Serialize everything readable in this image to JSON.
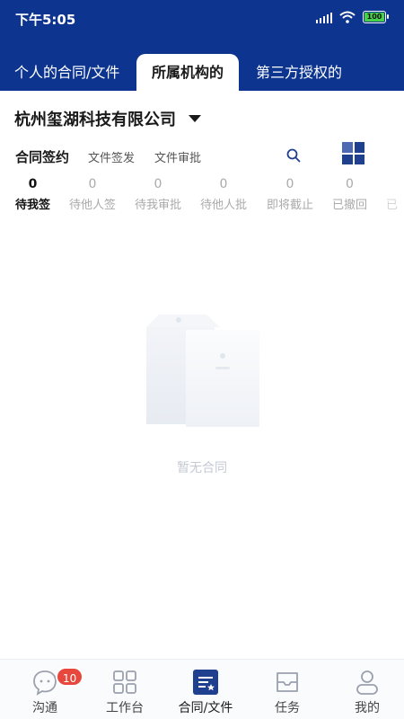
{
  "status_bar": {
    "time": "下午5:05",
    "battery": "100"
  },
  "top_tabs": [
    {
      "label": "个人的合同/文件"
    },
    {
      "label": "所属机构的"
    },
    {
      "label": "第三方授权的"
    }
  ],
  "company": {
    "name": "杭州玺湖科技有限公司"
  },
  "sub_tabs": [
    {
      "label": "合同签约"
    },
    {
      "label": "文件签发"
    },
    {
      "label": "文件审批"
    }
  ],
  "stats": [
    {
      "count": "0",
      "label": "待我签"
    },
    {
      "count": "0",
      "label": "待他人签"
    },
    {
      "count": "0",
      "label": "待我审批"
    },
    {
      "count": "0",
      "label": "待他人批"
    },
    {
      "count": "0",
      "label": "即将截止"
    },
    {
      "count": "0",
      "label": "已撤回"
    },
    {
      "count": "",
      "label": "已"
    }
  ],
  "empty": {
    "text": "暂无合同"
  },
  "bottom_nav": [
    {
      "label": "沟通",
      "badge": "10",
      "icon": "chat-bubble-icon"
    },
    {
      "label": "工作台",
      "icon": "grid-apps-icon"
    },
    {
      "label": "合同/文件",
      "icon": "contract-doc-icon"
    },
    {
      "label": "任务",
      "icon": "inbox-tray-icon"
    },
    {
      "label": "我的",
      "icon": "person-icon"
    }
  ],
  "colors": {
    "header_bg": "#0d3590",
    "accent": "#1f3f8f",
    "badge": "#e8473d"
  }
}
